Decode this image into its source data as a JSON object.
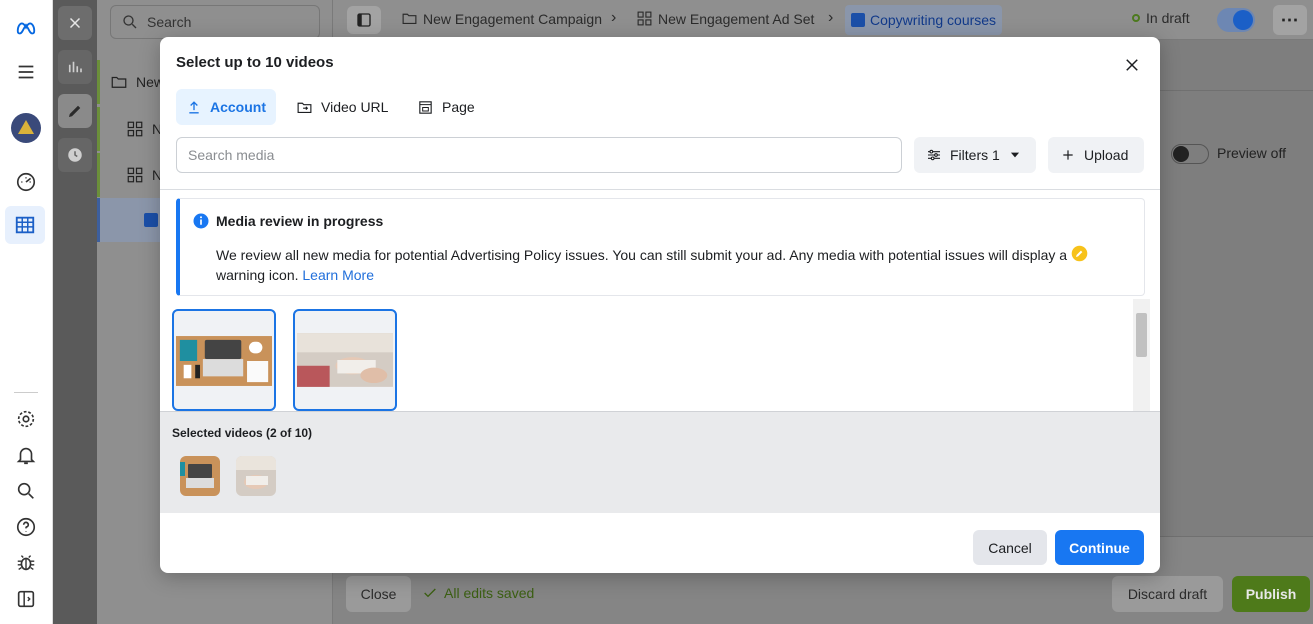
{
  "sidebar": {
    "search_placeholder": "Search",
    "tree": [
      {
        "label": "New"
      },
      {
        "label": "N"
      },
      {
        "label": "N"
      }
    ]
  },
  "header": {
    "breadcrumbs": [
      {
        "label": "New Engagement Campaign"
      },
      {
        "label": "New Engagement Ad Set"
      },
      {
        "label": "Copywriting courses"
      }
    ],
    "status": "In draft"
  },
  "preview": {
    "label": "Preview off"
  },
  "modal": {
    "title": "Select up to 10 videos",
    "tabs": [
      {
        "label": "Account"
      },
      {
        "label": "Video URL"
      },
      {
        "label": "Page"
      }
    ],
    "search_placeholder": "Search media",
    "filters_label": "Filters 1",
    "upload_label": "Upload",
    "notice": {
      "title": "Media review in progress",
      "body": "We review all new media for potential Advertising Policy issues. You can still submit your ad. Any media with potential issues will display a",
      "body_end": "warning icon.",
      "link": "Learn More"
    },
    "selected_label": "Selected videos (2 of 10)",
    "cancel_label": "Cancel",
    "continue_label": "Continue"
  },
  "footer": {
    "close_label": "Close",
    "saved_label": "All edits saved",
    "discard_label": "Discard draft",
    "publish_label": "Publish"
  },
  "colors": {
    "accent": "#1877f2",
    "publish": "#5b8a1e",
    "warning": "#f7c21b"
  }
}
